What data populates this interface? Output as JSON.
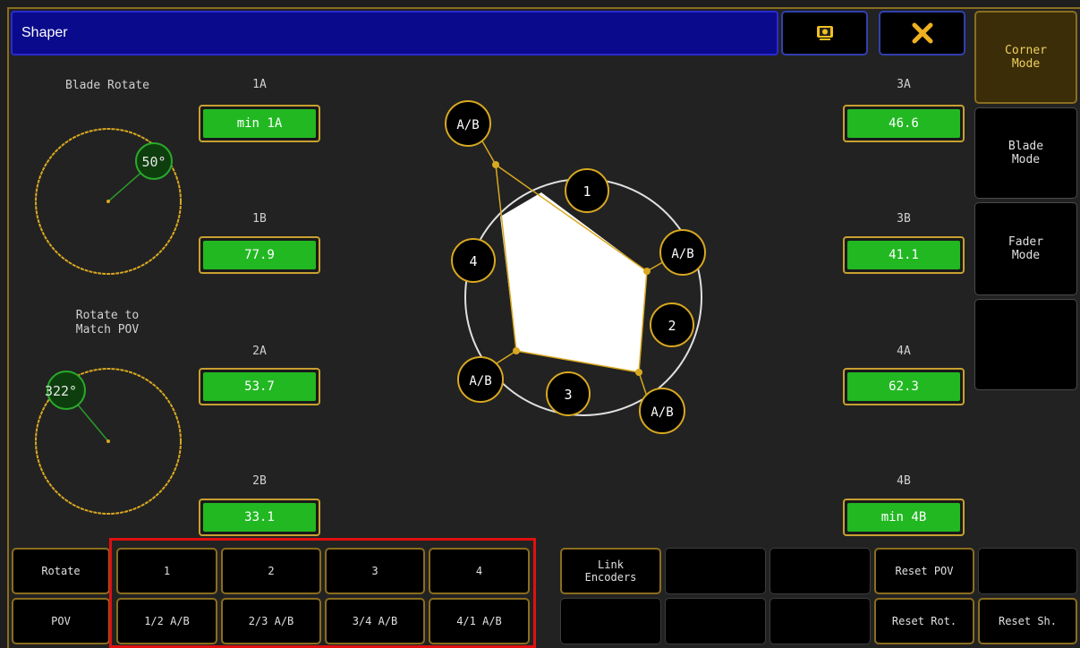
{
  "window": {
    "title": "Shaper"
  },
  "toolbar": {
    "screenshot_icon": "screenshot-icon",
    "close_icon": "close-icon"
  },
  "side_modes": [
    {
      "label": "Corner\nMode",
      "active": true
    },
    {
      "label": "Blade\nMode",
      "active": false
    },
    {
      "label": "Fader\nMode",
      "active": false
    },
    {
      "label": "",
      "active": false
    }
  ],
  "dials": [
    {
      "label": "Blade Rotate",
      "value": "50°"
    },
    {
      "label": "Rotate to\nMatch POV",
      "value": "322°"
    }
  ],
  "fields": {
    "f1a": {
      "label": "1A",
      "value": "min 1A"
    },
    "f1b": {
      "label": "1B",
      "value": "77.9"
    },
    "f2a": {
      "label": "2A",
      "value": "53.7"
    },
    "f2b": {
      "label": "2B",
      "value": "33.1"
    },
    "f3a": {
      "label": "3A",
      "value": "46.6"
    },
    "f3b": {
      "label": "3B",
      "value": "41.1"
    },
    "f4a": {
      "label": "4A",
      "value": "62.3"
    },
    "f4b": {
      "label": "4B",
      "value": "min 4B"
    }
  },
  "shape": {
    "blade_labels": [
      "1",
      "2",
      "3",
      "4"
    ],
    "corner_label": "A/B"
  },
  "bottom_row1": [
    "Rotate",
    "1",
    "2",
    "3",
    "4",
    "Link\nEncoders",
    "",
    "",
    "Reset POV",
    ""
  ],
  "bottom_row2": [
    "POV",
    "1/2 A/B",
    "2/3 A/B",
    "3/4 A/B",
    "4/1 A/B",
    "",
    "",
    "",
    "Reset Rot.",
    "Reset Sh."
  ],
  "colors": {
    "accent": "#c8a030",
    "value_green": "#22b822",
    "title_blue": "#0a0a8c",
    "highlight_red": "#e01010"
  }
}
